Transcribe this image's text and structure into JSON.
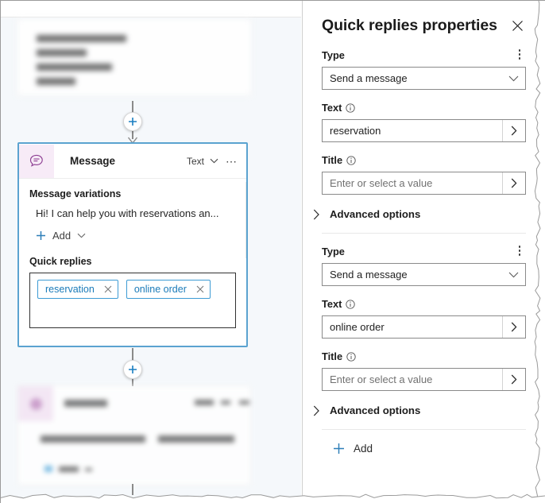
{
  "canvas": {
    "message_card": {
      "icon": "chat-message-icon",
      "title": "Message",
      "type_label": "Text",
      "more_icon": "ellipsis-icon",
      "variations_label": "Message variations",
      "variation_text": "Hi! I can help you with reservations an...",
      "add_label": "Add",
      "add_icon": "plus-icon",
      "add_chevron_icon": "chevron-down-icon",
      "quick_replies_label": "Quick replies",
      "chips": [
        {
          "label": "reservation",
          "remove_icon": "close-icon"
        },
        {
          "label": "online order",
          "remove_icon": "close-icon"
        }
      ]
    },
    "connectors": [
      {
        "name": "add-node-above",
        "icon": "plus-icon"
      },
      {
        "name": "add-node-below",
        "icon": "plus-icon"
      }
    ],
    "accent_selected": "#5ba3d0",
    "accent_blue": "#1b7bb9",
    "background": "#f5f8fb"
  },
  "panel": {
    "title": "Quick replies properties",
    "close_icon": "close-icon",
    "groups": [
      {
        "kebab_icon": "kebab-menu-icon",
        "type_label": "Type",
        "type_value": "Send a message",
        "type_chevron_icon": "chevron-down-icon",
        "text_label": "Text",
        "text_info_icon": "info-icon",
        "text_value": "reservation",
        "text_arrow_icon": "chevron-right-icon",
        "title_label": "Title",
        "title_info_icon": "info-icon",
        "title_placeholder": "Enter or select a value",
        "title_arrow_icon": "chevron-right-icon",
        "advanced_label": "Advanced options",
        "advanced_chevron_icon": "chevron-right-icon"
      },
      {
        "kebab_icon": "kebab-menu-icon",
        "type_label": "Type",
        "type_value": "Send a message",
        "type_chevron_icon": "chevron-down-icon",
        "text_label": "Text",
        "text_info_icon": "info-icon",
        "text_value": "online order",
        "text_arrow_icon": "chevron-right-icon",
        "title_label": "Title",
        "title_info_icon": "info-icon",
        "title_placeholder": "Enter or select a value",
        "title_arrow_icon": "chevron-right-icon",
        "advanced_label": "Advanced options",
        "advanced_chevron_icon": "chevron-right-icon"
      }
    ],
    "add_label": "Add",
    "add_icon": "plus-icon"
  }
}
